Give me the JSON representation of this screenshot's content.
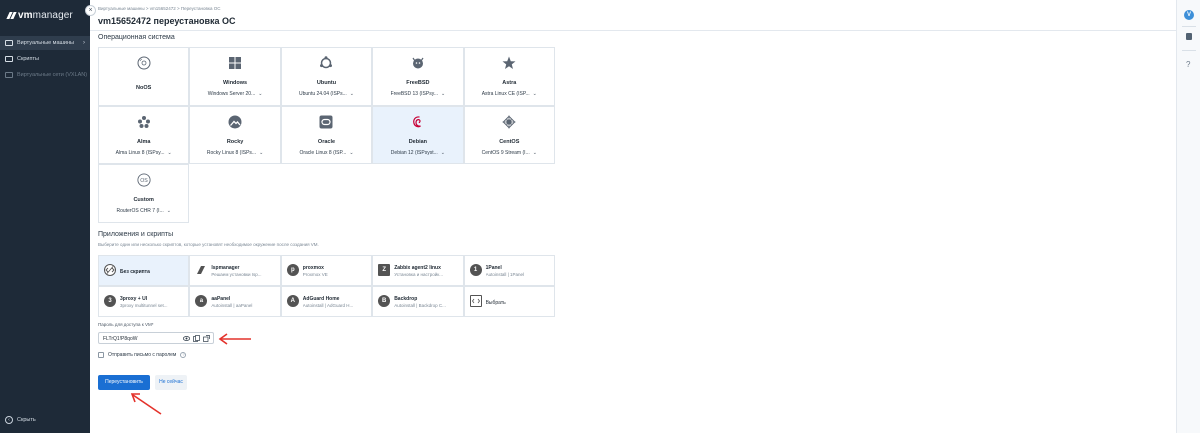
{
  "app": {
    "logo_bold": "vm",
    "logo_light": "manager",
    "collapse_icon": "close-icon"
  },
  "sidebar": {
    "items": [
      {
        "label": "Виртуальные машины",
        "icon": "vm-icon",
        "active": true
      },
      {
        "label": "Скрипты",
        "icon": "scripts-icon",
        "active": false
      },
      {
        "label": "Виртуальные сети (VXLAN)",
        "icon": "network-icon",
        "active": false
      }
    ],
    "footer_label": "Скрыть"
  },
  "right_rail": {
    "avatar_letter": "V",
    "help_label": "?"
  },
  "header": {
    "breadcrumb": "Виртуальные машины  >  vm15652472  >  Переустановка ОС",
    "title": "vm15652472 переустановка ОС"
  },
  "os_section": {
    "title": "Операционная система",
    "cards": [
      {
        "name": "NoOS",
        "version": "",
        "icon": "disc-icon",
        "selected": false
      },
      {
        "name": "Windows",
        "version": "Windows Server 20...",
        "icon": "windows-icon",
        "selected": false
      },
      {
        "name": "Ubuntu",
        "version": "Ubuntu 24.04 (ISPs...",
        "icon": "ubuntu-icon",
        "selected": false
      },
      {
        "name": "FreeBSD",
        "version": "FreeBSD 13 (ISPsy...",
        "icon": "freebsd-icon",
        "selected": false
      },
      {
        "name": "Astra",
        "version": "Astra Linux CE (ISP...",
        "icon": "astra-icon",
        "selected": false
      },
      {
        "name": "Alma",
        "version": "Alma Linux 8 (ISPsy...",
        "icon": "alma-icon",
        "selected": false
      },
      {
        "name": "Rocky",
        "version": "Rocky Linux 8 (ISPs...",
        "icon": "rocky-icon",
        "selected": false
      },
      {
        "name": "Oracle",
        "version": "Oracle Linux 8 (ISP...",
        "icon": "oracle-icon",
        "selected": false
      },
      {
        "name": "Debian",
        "version": "Debian 12 (ISPsyst...",
        "icon": "debian-icon",
        "selected": true
      },
      {
        "name": "CentOS",
        "version": "CentOS 9 Stream (I...",
        "icon": "centos-icon",
        "selected": false
      },
      {
        "name": "Custom",
        "version": "RouterOS CHR 7 (I...",
        "icon": "custom-os-icon",
        "selected": false
      }
    ]
  },
  "scripts_section": {
    "title": "Приложения и скрипты",
    "subtitle": "Выберите один или несколько скриптов, которые установят необходимое окружение после создания VM.",
    "cards": [
      {
        "name": "Без скрипта",
        "desc": "",
        "icon_letter": "",
        "icon": "no-script-icon",
        "selected": true
      },
      {
        "name": "Ispmanager",
        "desc": "Решаем установки Isp...",
        "icon_letter": "",
        "icon": "ispmanager-icon",
        "selected": false
      },
      {
        "name": "proxmox",
        "desc": "Proxmox VE",
        "icon_letter": "p",
        "icon": "proxmox-icon",
        "selected": false
      },
      {
        "name": "Zabbix agent2 linux",
        "desc": "Установка и настройк...",
        "icon_letter": "Z",
        "icon": "zabbix-icon",
        "selected": false
      },
      {
        "name": "1Panel",
        "desc": "Autoinstall | 1Panel",
        "icon_letter": "1",
        "icon": "onepanel-icon",
        "selected": false
      },
      {
        "name": "3proxy + UI",
        "desc": "3proxy multitunnel set...",
        "icon_letter": "3",
        "icon": "threeproxy-icon",
        "selected": false
      },
      {
        "name": "aaPanel",
        "desc": "Autoinstall | aaPanel",
        "icon_letter": "a",
        "icon": "aapanel-icon",
        "selected": false
      },
      {
        "name": "AdGuard Home",
        "desc": "Autoinstall | AdGuard H...",
        "icon_letter": "A",
        "icon": "adguard-icon",
        "selected": false
      },
      {
        "name": "Backdrop",
        "desc": "Autoinstall | Backdrop C...",
        "icon_letter": "B",
        "icon": "backdrop-icon",
        "selected": false
      },
      {
        "name": "Выбрать",
        "desc": "",
        "icon_letter": "",
        "icon": "choose-script-icon",
        "selected": false
      }
    ]
  },
  "password": {
    "label": "Пароль для доступа к VM*",
    "value": "FLTrQ1!P8qoW",
    "show_icon": "eye-icon",
    "copy_icon": "copy-icon",
    "generate_icon": "generate-icon"
  },
  "email_checkbox": {
    "label": "Отправить письмо с паролем",
    "checked": false
  },
  "actions": {
    "primary_label": "Переустановить",
    "secondary_label": "Не сейчас"
  },
  "colors": {
    "sidebar_bg": "#1e2a38",
    "primary": "#1a6fd3",
    "selected_card_bg": "#e9f2fc",
    "annotation_red": "#e4322b"
  }
}
